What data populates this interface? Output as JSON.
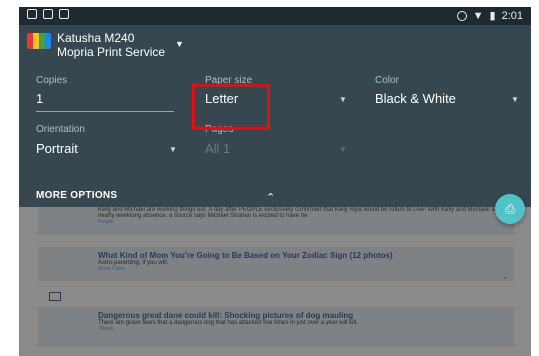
{
  "status_bar": {
    "time": "2:01"
  },
  "printer": {
    "name": "Katusha M240",
    "service": "Mopria Print Service"
  },
  "fields": {
    "copies": {
      "label": "Copies",
      "value": "1"
    },
    "paper_size": {
      "label": "Paper size",
      "value": "Letter"
    },
    "color": {
      "label": "Color",
      "value": "Black & White"
    },
    "orientation": {
      "label": "Orientation",
      "value": "Portrait"
    },
    "pages": {
      "label": "Pages",
      "value": "All 1"
    }
  },
  "more_options_label": "MORE OPTIONS",
  "colors": {
    "panel": "#37474f",
    "highlight": "#e01010",
    "fab": "#4fc3c8"
  },
  "background_articles": [
    {
      "title": "",
      "desc": "Kelly and Michael are working things out. A day after PEOPLE exclusively confirmed that Kelly Ripa would be return to Live! With Kelly and Michael! after a nearly weeklong absence, a source says Michael Strahan is excited to have he",
      "source": "People"
    },
    {
      "title": "What Kind of Mom You're Going to Be Based on Your Zodiac Sign (12 photos)",
      "desc": "Astro-parenting, if you will.",
      "source": "Marie Claire"
    },
    {
      "title": "Dangerous great dane could kill: Shocking pictures of dog mauling",
      "desc": "There are grave fears that a dangerous dog that has attacked five times in just over a year will kill.",
      "source": "7News"
    }
  ]
}
